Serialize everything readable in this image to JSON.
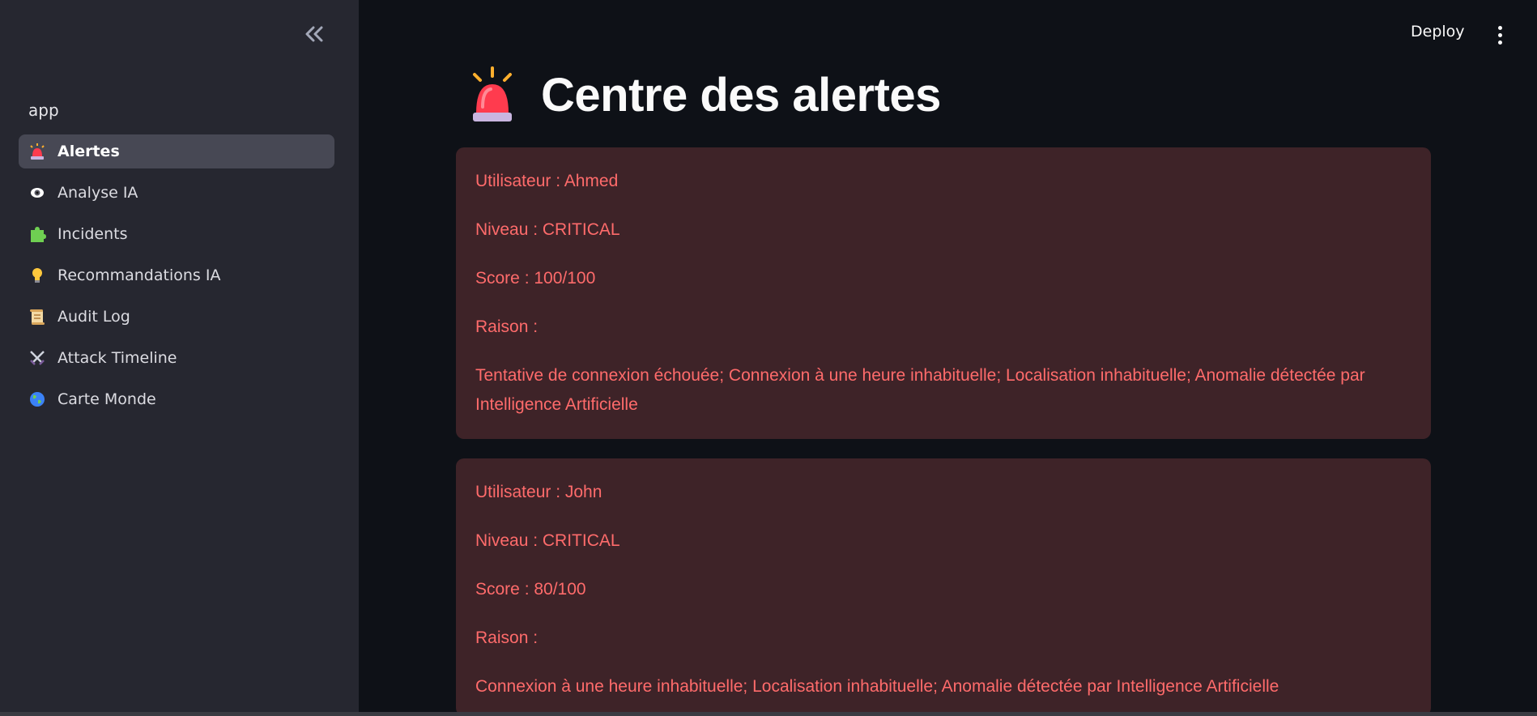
{
  "sidebar": {
    "app_label": "app",
    "items": [
      {
        "label": "Alertes",
        "icon": "siren-icon",
        "active": true
      },
      {
        "label": "Analyse IA",
        "icon": "eye-icon"
      },
      {
        "label": "Incidents",
        "icon": "puzzle-icon"
      },
      {
        "label": "Recommandations IA",
        "icon": "lightbulb-icon"
      },
      {
        "label": "Audit Log",
        "icon": "scroll-icon"
      },
      {
        "label": "Attack Timeline",
        "icon": "crossed-swords-icon"
      },
      {
        "label": "Carte Monde",
        "icon": "globe-icon"
      }
    ]
  },
  "header": {
    "deploy_label": "Deploy"
  },
  "main": {
    "title": "Centre des alertes",
    "alerts": [
      {
        "user": "Utilisateur : Ahmed",
        "level": "Niveau : CRITICAL",
        "score": "Score : 100/100",
        "reason_label": "Raison :",
        "reason": "Tentative de connexion échouée; Connexion à une heure inhabituelle; Localisation inhabituelle; Anomalie détectée par Intelligence Artificielle"
      },
      {
        "user": "Utilisateur : John",
        "level": "Niveau : CRITICAL",
        "score": "Score : 80/100",
        "reason_label": "Raison :",
        "reason": "Connexion à une heure inhabituelle; Localisation inhabituelle; Anomalie détectée par Intelligence Artificielle"
      }
    ]
  },
  "colors": {
    "sidebar_bg": "#262730",
    "main_bg": "#0e1117",
    "alert_bg": "#3e2328",
    "alert_text": "#ff6b6b"
  }
}
